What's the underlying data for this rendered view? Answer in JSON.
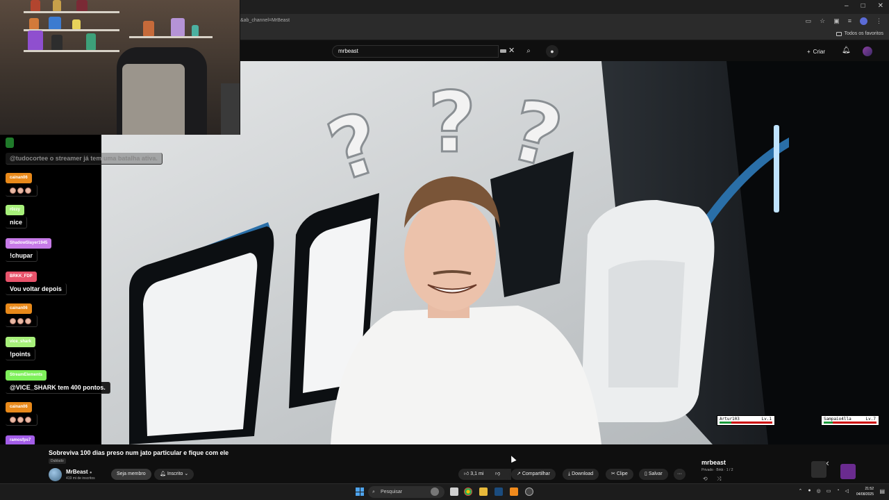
{
  "browser": {
    "url": "&ab_channel=MrBeast",
    "bookmarks_all": "Todos os favoritos",
    "window_controls": [
      "–",
      "□",
      "✕"
    ]
  },
  "yt": {
    "search_value": "mrbeast",
    "create_label": "Criar"
  },
  "chat": {
    "messages": [
      {
        "user": "",
        "text": "@tudocortee o streamer já tem uma batalha ativa.",
        "color": "#1f7a2a",
        "faded": true
      },
      {
        "user": "cainan06",
        "text": "",
        "emojis": 3,
        "color": "#e8891a"
      },
      {
        "user": "r0zzy",
        "text": "nice",
        "color": "#a7f07a"
      },
      {
        "user": "ShadowSlayer1945",
        "text": "!chupar",
        "color": "#c77ae8"
      },
      {
        "user": "BRKK_FDP",
        "text": "Vou voltar depois",
        "color": "#e8536b"
      },
      {
        "user": "cainan06",
        "text": "",
        "emojis": 3,
        "color": "#e8891a"
      },
      {
        "user": "vice_shark",
        "text": "!points",
        "color": "#a7f07a"
      },
      {
        "user": "StreamElements",
        "text": "@VICE_SHARK tem 400 pontos.",
        "color": "#7ef05a"
      },
      {
        "user": "cainan06",
        "text": "",
        "emojis": 3,
        "color": "#e8891a"
      },
      {
        "user": "ramosfps7",
        "text": "kkk",
        "color": "#a35de8"
      }
    ]
  },
  "video": {
    "title": "Sobreviva 100 dias preso num jato particular e fique com ele",
    "badge": "Dublado",
    "channel": "MrBeast",
    "subscribers": "419 mi de inscritos",
    "join_label": "Seja membro",
    "subscribed_label": "Inscrito",
    "likes": "3,1 mi",
    "share_label": "Compartilhar",
    "download_label": "Download",
    "clip_label": "Clipe",
    "save_label": "Salvar",
    "more_label": "···"
  },
  "overlay": {
    "player1": {
      "name": "Artur103",
      "level": "Lv.1",
      "hp": 0.22
    },
    "player2": {
      "name": "Sampaio4lla",
      "level": "Lv.7",
      "hp": 0.17
    }
  },
  "playlist": {
    "title": "mrbeast",
    "meta": "Privado · Brkk · 1 / 2"
  },
  "taskbar": {
    "search_placeholder": "Pesquisar",
    "time": "21:52",
    "date": "04/08/2025"
  },
  "colors": {
    "accent_blue": "#4ea4ee",
    "page_bg": "#0f0f0f"
  }
}
